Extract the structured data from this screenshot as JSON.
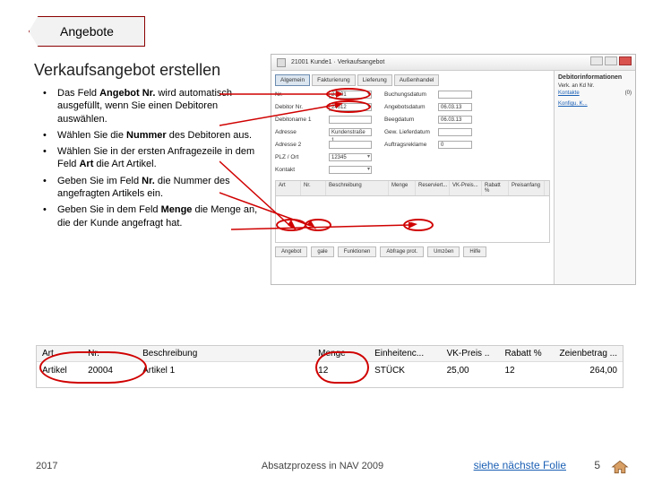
{
  "tab_label": "Angebote",
  "heading": "Verkaufsangebot erstellen",
  "bullets": [
    {
      "pre": "Das Feld ",
      "b": "Angebot Nr. ",
      "post": "wird automatisch ausgefüllt, wenn Sie einen Debitoren auswählen."
    },
    {
      "pre": "Wählen Sie die ",
      "b": "Nummer ",
      "post": "des Debitoren aus."
    },
    {
      "pre": "Wählen Sie in der ersten Anfragezeile in dem Feld ",
      "b": "Art ",
      "post": "die Art Artikel."
    },
    {
      "pre": "Geben Sie im Feld ",
      "b": "Nr. ",
      "post": "die Nummer des angefragten Artikels ein."
    },
    {
      "pre": "Geben Sie in dem Feld ",
      "b": "Menge ",
      "post": "die Menge an, die der Kunde angefragt hat."
    }
  ],
  "screenshot": {
    "title_num": "21001",
    "title_name": "Kunde1",
    "title_doc": "Verkaufsangebot",
    "tabs": [
      "Algemein",
      "Fakturierung",
      "Lieferung",
      "Außenhandel"
    ],
    "right_header": "Debitorinformationen",
    "right_sub1": "Verk. an Kd Nr.",
    "right_linklabel": "Kontakte",
    "right_linkval": "(0)",
    "right_cfg": "Konfigu. K...",
    "form": {
      "r1_lbl": "Nr.",
      "r1_val": "21001",
      "r1b_lbl": "Buchungsdatum",
      "r2_lbl": "Debitor Nr.",
      "r2_val": "24612",
      "r2b_lbl": "Angebotsdatum",
      "r2b_val": "06.03.13",
      "r3_lbl": "Debitoname 1",
      "r3b_lbl": "Beegdatum",
      "r3b_val": "06.03.13",
      "r4_lbl": "Adresse",
      "r4_val": "Kundenstraße 1",
      "r4b_lbl": "Gew. Lieferdatum",
      "r5_lbl": "Adresse 2",
      "r5b_lbl": "Auftragsreklame",
      "r5b_val": "0",
      "r6_lbl": "PLZ / Ort",
      "r6_val": "12345",
      "r7_lbl": "Kontakt"
    },
    "grid_cols": [
      "Art",
      "Nr.",
      "Beschreibung",
      "Menge",
      "Reserviert...",
      "VK-Preis...",
      "Rabatt %",
      "Preisanfang"
    ],
    "buttons": [
      "Angebot",
      "gale",
      "Funktionen",
      "Abfrage prot.",
      "Umzöen",
      "Hilfe"
    ]
  },
  "table": {
    "cols": [
      "Art",
      "Nr.",
      "Beschreibung",
      "Menge",
      "Einheitenc...",
      "VK-Preis ..",
      "Rabatt %",
      "Zeienbetrag ..."
    ],
    "row": [
      "Artikel",
      "20004",
      "Artikel 1",
      "12",
      "STÜCK",
      "25,00",
      "12",
      "264,00"
    ]
  },
  "footer": {
    "year": "2017",
    "mid": "Absatzprozess in NAV 2009",
    "link": "siehe  nächste Folie",
    "page": "5"
  }
}
